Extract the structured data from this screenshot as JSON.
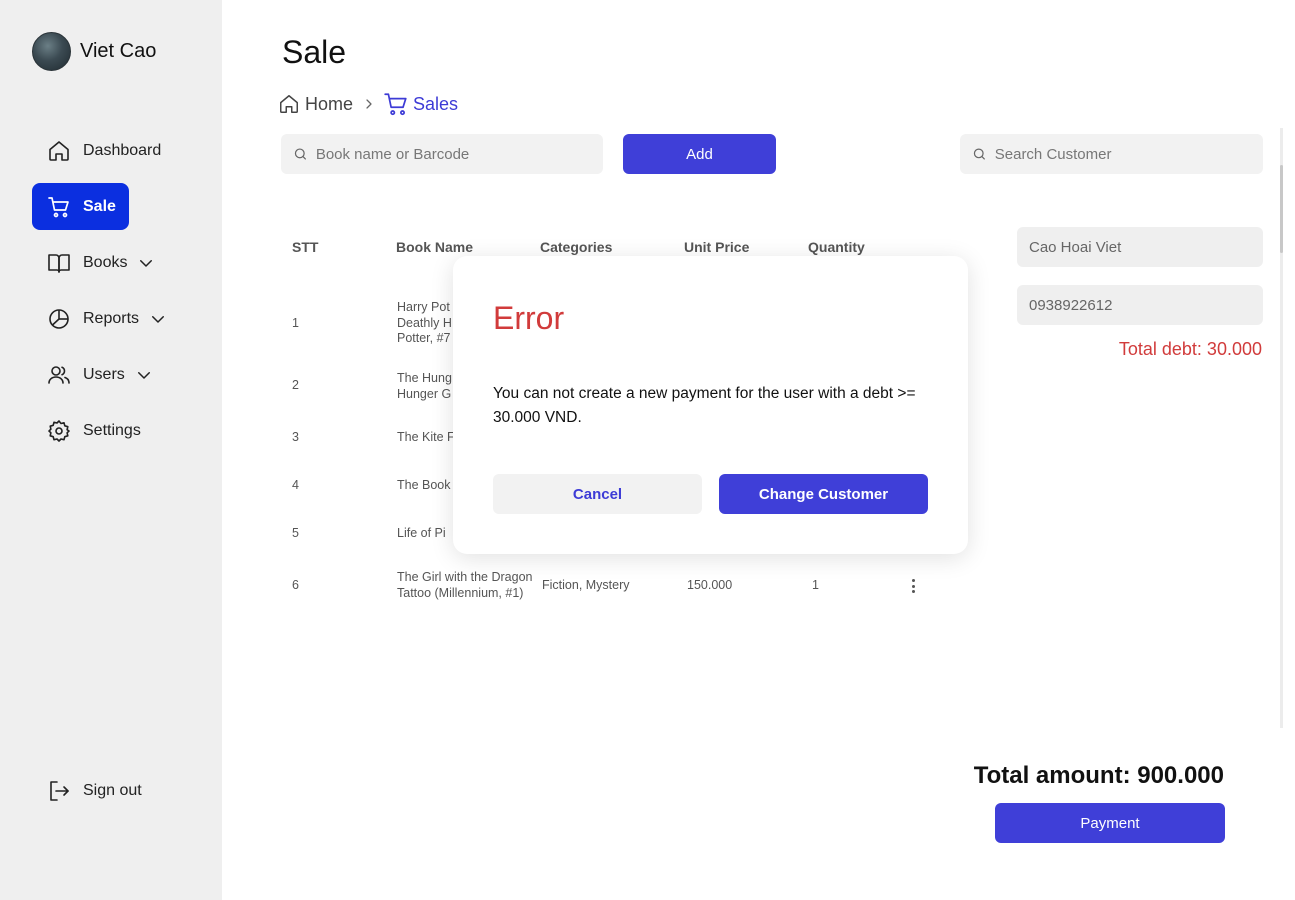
{
  "user": {
    "name": "Viet Cao"
  },
  "sidebar": {
    "items": [
      {
        "label": "Dashboard",
        "icon": "home-icon"
      },
      {
        "label": "Sale",
        "icon": "cart-icon",
        "active": true
      },
      {
        "label": "Books",
        "icon": "book-icon",
        "expandable": true
      },
      {
        "label": "Reports",
        "icon": "pie-chart-icon",
        "expandable": true
      },
      {
        "label": "Users",
        "icon": "users-icon",
        "expandable": true
      },
      {
        "label": "Settings",
        "icon": "gear-icon"
      }
    ],
    "signout": "Sign out"
  },
  "page": {
    "title": "Sale"
  },
  "breadcrumb": {
    "home": "Home",
    "current": "Sales"
  },
  "search": {
    "book_placeholder": "Book name or Barcode",
    "add_label": "Add",
    "customer_placeholder": "Search Customer"
  },
  "table": {
    "headers": [
      "STT",
      "Book Name",
      "Categories",
      "Unit Price",
      "Quantity"
    ],
    "rows": [
      {
        "stt": "1",
        "name_l1": "Harry Pot",
        "name_l2": "Deathly H",
        "name_l3": "Potter, #7",
        "categories": "",
        "price": "",
        "qty": ""
      },
      {
        "stt": "2",
        "name_l1": "The Hung",
        "name_l2": "Hunger G",
        "categories": "",
        "price": "",
        "qty": ""
      },
      {
        "stt": "3",
        "name_l1": "The Kite F",
        "categories": "",
        "price": "",
        "qty": ""
      },
      {
        "stt": "4",
        "name_l1": "The Book",
        "categories": "",
        "price": "",
        "qty": ""
      },
      {
        "stt": "5",
        "name_l1": "Life of Pi",
        "categories": "",
        "price": "",
        "qty": ""
      },
      {
        "stt": "6",
        "name_l1": "The Girl with the Dragon",
        "name_l2": "Tattoo (Millennium, #1)",
        "categories": "Fiction, Mystery",
        "price": "150.000",
        "qty": "1"
      }
    ]
  },
  "customer": {
    "name": "Cao Hoai Viet",
    "phone": "0938922612",
    "total_debt": "Total debt: 30.000"
  },
  "footer": {
    "total_amount": "Total amount: 900.000",
    "payment_label": "Payment"
  },
  "modal": {
    "title": "Error",
    "message": "You can not create a new payment for the user with a debt >= 30.000 VND.",
    "cancel_label": "Cancel",
    "change_label": "Change Customer"
  },
  "colors": {
    "primary": "#3f3fd8",
    "active_nav": "#0b2fe0",
    "error": "#d13b3b",
    "sidebar_bg": "#efefef"
  }
}
